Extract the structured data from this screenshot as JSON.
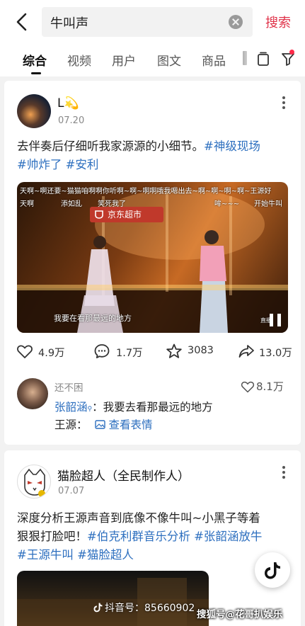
{
  "search": {
    "query": "牛叫声",
    "button_label": "搜索"
  },
  "tabs": [
    {
      "label": "综合",
      "active": true
    },
    {
      "label": "视频",
      "active": false
    },
    {
      "label": "用户",
      "active": false
    },
    {
      "label": "图文",
      "active": false
    },
    {
      "label": "商品",
      "active": false
    }
  ],
  "post1": {
    "author": "L",
    "author_emoji": "💫",
    "date": "07.20",
    "text": "去伴奏后仔细听我家源源的小细节。",
    "tags_inline": "#神级现场",
    "tags_line2_a": "#帅炸了",
    "tags_line2_b": "#安利",
    "video": {
      "danmu_top": "天啊~啊还要~猫猫咱啊啊你听啊~啊~啊啊哦我嗯出去~啊~啊~啊~啊~王源好",
      "danmu_left1": "天啊",
      "danmu_left2": "添如乱",
      "danmu_left3": "笑死我了",
      "danmu_right1": "哞~~~",
      "danmu_right2": "开始牛叫",
      "badge": "京东超市",
      "subtitle": "我要在看那最远的地方",
      "corner_text": "直播"
    },
    "actions": {
      "likes": "4.9万",
      "comments": "1.7万",
      "favorites": "3083",
      "shares": "13.0万"
    },
    "top_comment": {
      "user": "还不困",
      "likes": "8.1万",
      "line1_name": "张韶涵",
      "line1_text": "：我要去看那最远的地方",
      "line2_name": "王源：",
      "line2_text": "查看表情"
    }
  },
  "post2": {
    "author": "猫脸超人（全民制作人）",
    "date": "07.07",
    "text_line1": "深度分析王源声音到底像不像牛叫~小黑子等着",
    "text_line2_plain": "狠狠打脸吧！",
    "text_line2_tags": "#伯克利群音乐分析 #张韶涵放牛",
    "text_line3_tags": "#王源牛叫 #猫脸超人"
  },
  "watermarks": {
    "douyin": "抖音号：85660902",
    "sohu": "搜狐号@花哥扒娱乐"
  },
  "colors": {
    "accent": "#e0334a",
    "tag_blue": "#2d6fbf",
    "background": "#f2f2f2"
  }
}
